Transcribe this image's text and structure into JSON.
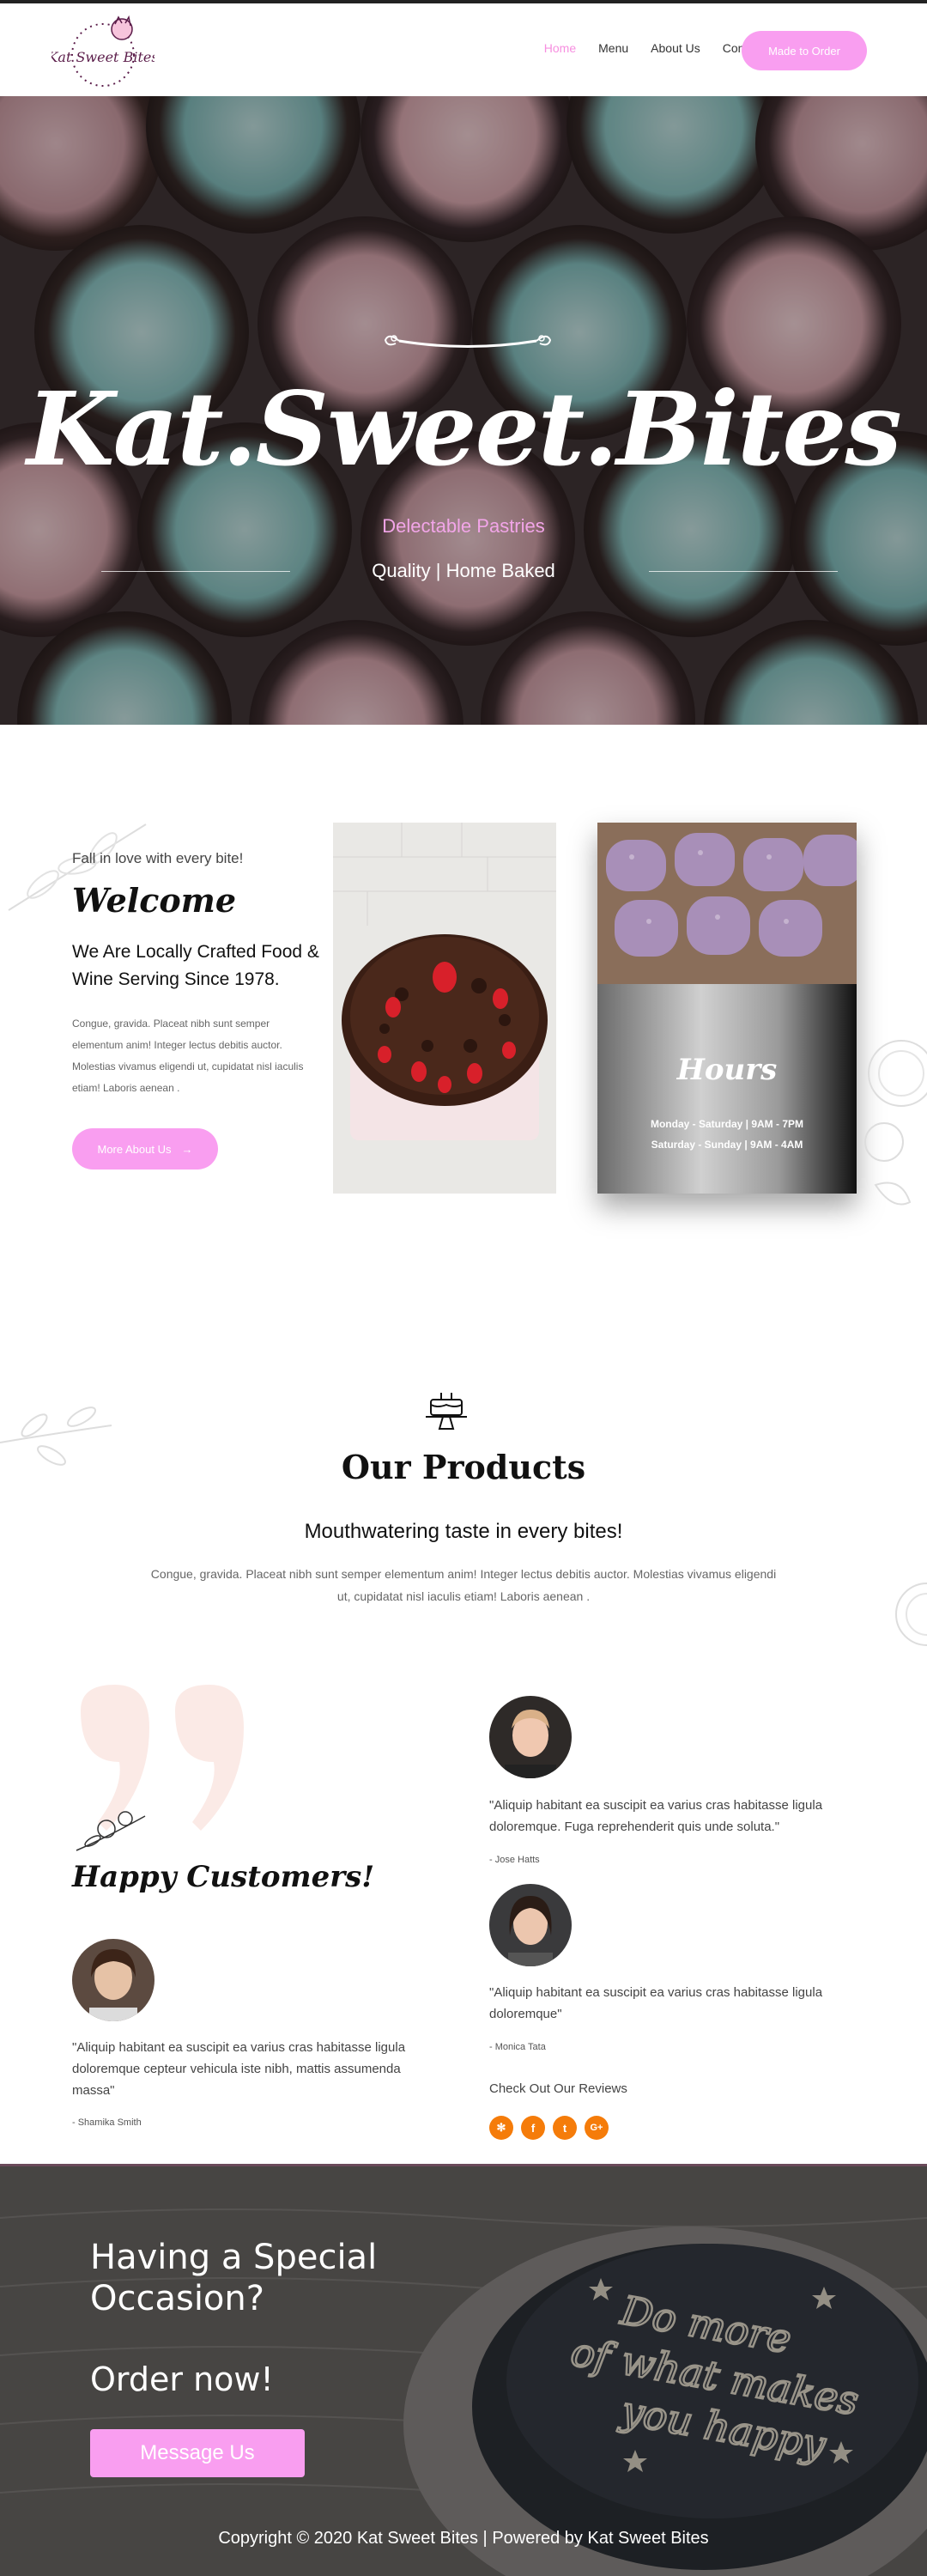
{
  "header": {
    "logo_text": "Kat Sweet Bites",
    "nav": [
      {
        "label": "Home",
        "active": true
      },
      {
        "label": "Menu",
        "active": false
      },
      {
        "label": "About Us",
        "active": false
      },
      {
        "label": "Contact",
        "active": false
      }
    ],
    "order_button": "Made to Order"
  },
  "hero": {
    "title": "Kat.Sweet.Bites",
    "subtitle": "Delectable Pastries",
    "tagline": "Quality | Home Baked"
  },
  "welcome": {
    "intro": "Fall in love with every bite!",
    "title": "Welcome",
    "heading": "We Are Locally Crafted Food & Wine Serving Since 1978.",
    "text": "Congue, gravida. Placeat nibh sunt semper elementum anim! Integer lectus debitis auctor. Molestias vivamus eligendi ut, cupidatat nisl iaculis etiam! Laboris aenean .",
    "button": "More About Us"
  },
  "hours": {
    "title": "Hours",
    "weekday": "Monday - Saturday | 9AM - 7PM",
    "weekend": "Saturday - Sunday | 9AM - 4AM"
  },
  "products": {
    "title": "Our Products",
    "subtitle": "Mouthwatering taste in every bites!",
    "text": "Congue, gravida. Placeat nibh sunt semper elementum anim! Integer lectus debitis auctor. Molestias vivamus eligendi ut, cupidatat nisl iaculis etiam! Laboris aenean ."
  },
  "testimonials": {
    "title": "Happy Customers!",
    "items": [
      {
        "quote": "\"Aliquip habitant ea suscipit ea varius cras habitasse ligula doloremque cepteur vehicula iste nibh, mattis assumenda massa\"",
        "name": "- Shamika Smith"
      },
      {
        "quote": "\"Aliquip habitant ea suscipit ea varius cras habitasse ligula doloremque. Fuga reprehenderit quis unde soluta.\"",
        "name": "- Jose Hatts"
      },
      {
        "quote": "\"Aliquip habitant ea suscipit ea varius cras habitasse ligula doloremque\"",
        "name": "- Monica Tata"
      }
    ],
    "reviews_label": "Check Out Our Reviews",
    "social_icons": [
      "yelp-icon",
      "facebook-icon",
      "twitter-icon",
      "google-plus-icon"
    ]
  },
  "footer": {
    "question": "Having a Special Occasion?",
    "order_now": "Order now!",
    "button": "Message Us",
    "copyright": "Copyright © 2020 Kat Sweet Bites | Powered by Kat Sweet Bites",
    "cake_text": "Do more of what makes you happy"
  },
  "colors": {
    "accent": "#f99ef0",
    "social": "#f57c0a"
  }
}
